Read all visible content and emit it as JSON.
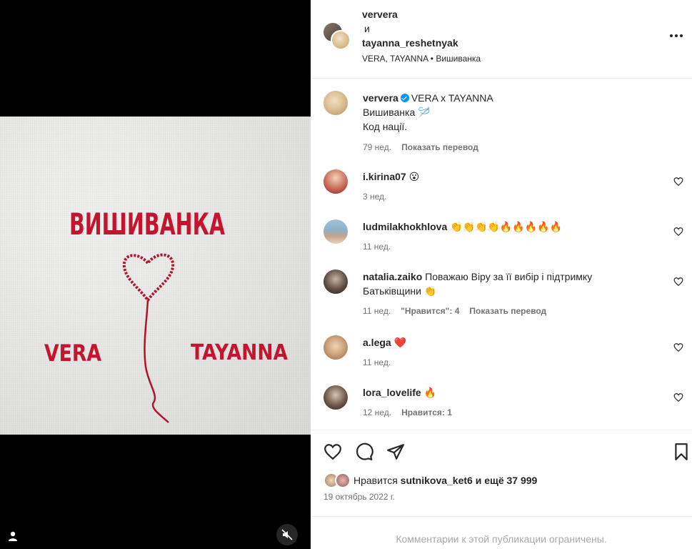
{
  "colors": {
    "accent": "#0095f6",
    "embroidery": "#c4142e",
    "muted": "#737373"
  },
  "media": {
    "embroidery_title": "ВИШИВАНКА",
    "embroidery_left": "VERA",
    "embroidery_right": "TAYANNA"
  },
  "header": {
    "user1": "ververa",
    "and": "и",
    "user2": "tayanna_reshetnyak",
    "subtitle": "VERA, TAYANNA • Вишиванка",
    "more_icon": "more-horizontal-icon"
  },
  "caption": {
    "user": "ververa",
    "line1": "VERA x TAYANNA",
    "line2": "Вишиванка 🪡",
    "line3": "Код нації.",
    "time": "79 нед.",
    "translate": "Показать перевод"
  },
  "comments": [
    {
      "user": "i.kirina07",
      "text": "😮",
      "time": "3 нед.",
      "likes": "",
      "translate": ""
    },
    {
      "user": "ludmilakhokhlova",
      "text": "👏👏👏👏🔥🔥🔥🔥🔥",
      "time": "11 нед.",
      "likes": "",
      "translate": ""
    },
    {
      "user": "natalia.zaiko",
      "text": "Поважаю Віру за її вибір і підтримку Батьківщини 👏",
      "time": "11 нед.",
      "likes": "\"Нравится\": 4",
      "translate": "Показать перевод"
    },
    {
      "user": "a.lega",
      "text": "❤️",
      "time": "11 нед.",
      "likes": "",
      "translate": ""
    },
    {
      "user": "lora_lovelife",
      "text": "🔥",
      "time": "12 нед.",
      "likes": "Нравится: 1",
      "translate": ""
    }
  ],
  "likes": {
    "prefix": "Нравится",
    "user": "sutnikova_ket6",
    "suffix": "и ещё 37 999"
  },
  "date": "19 октябрь 2022 г.",
  "footer": "Комментарии к этой публикации ограничены."
}
